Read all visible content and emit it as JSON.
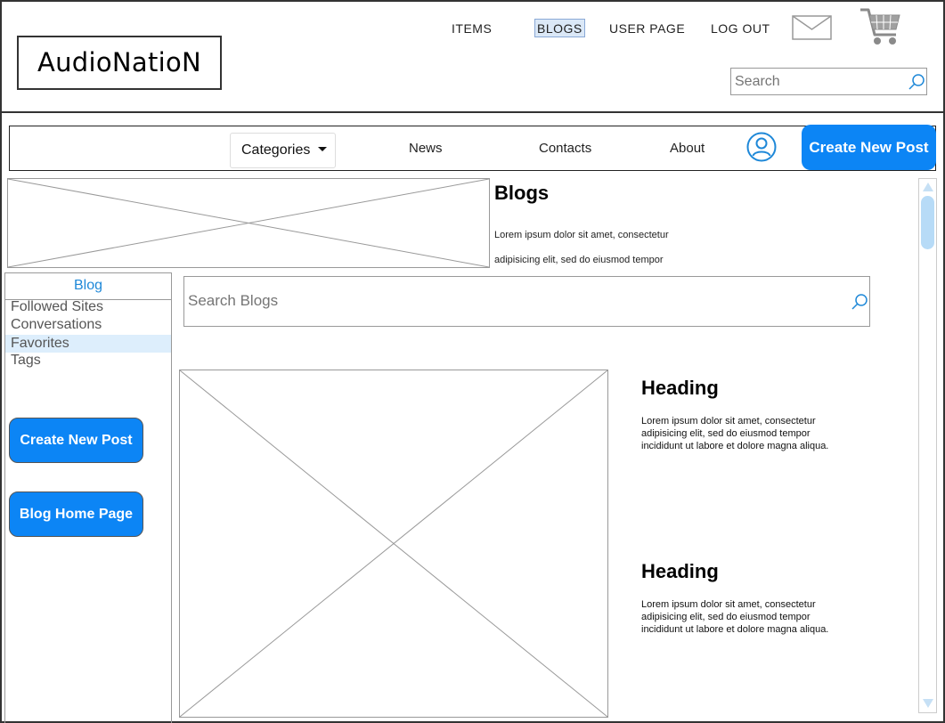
{
  "app": {
    "logo": "AudioNatioN"
  },
  "top_nav": {
    "items": [
      "ITEMS",
      "BLOGS",
      "USER PAGE",
      "LOG OUT"
    ],
    "active": "BLOGS"
  },
  "top_search": {
    "placeholder": "Search"
  },
  "nav_bar": {
    "categories": "Categories",
    "links": [
      "News",
      "Contacts",
      "About"
    ],
    "create_post": "Create New Post"
  },
  "banner": {
    "title": "Blogs",
    "desc_line1": "Lorem ipsum dolor sit amet, consectetur",
    "desc_line2": "adipisicing elit, sed do eiusmod tempor"
  },
  "sidebar": {
    "title": "Blog",
    "items": [
      "Followed Sites",
      "Conversations",
      "Favorites",
      "Tags"
    ],
    "selected": "Favorites",
    "create_post": "Create New Post",
    "blog_home": "Blog Home Page"
  },
  "blog_search": {
    "placeholder": "Search Blogs"
  },
  "articles": [
    {
      "heading": "Heading",
      "text": "Lorem ipsum dolor sit amet, consectetur adipisicing elit, sed do eiusmod tempor incididunt ut labore et dolore magna aliqua."
    },
    {
      "heading": "Heading",
      "text": "Lorem ipsum dolor sit amet, consectetur adipisicing elit, sed do eiusmod tempor incididunt ut labore et dolore magna aliqua."
    }
  ],
  "colors": {
    "accent": "#0c85f5",
    "link_blue": "#1e88d8",
    "selected_bg": "#ddeefc"
  },
  "icons": [
    "mail-icon",
    "cart-icon",
    "search-icon",
    "chevron-down-icon",
    "user-icon",
    "image-placeholder-icon"
  ]
}
